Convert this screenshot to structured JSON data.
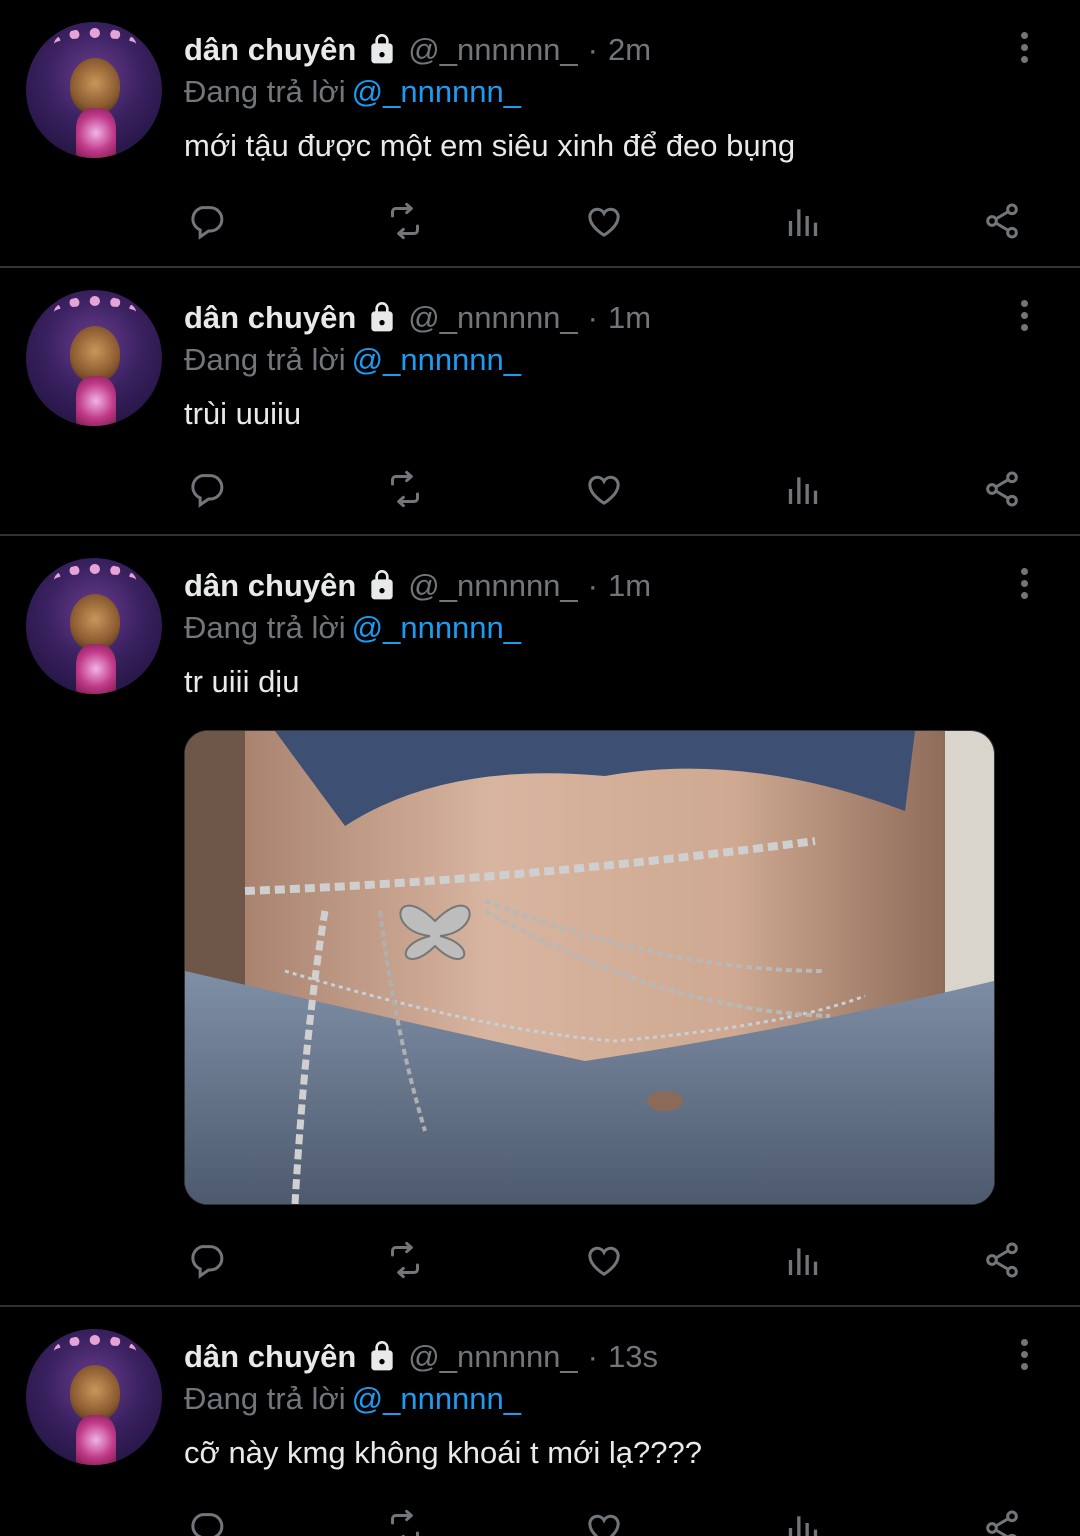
{
  "tweets": [
    {
      "name": "dân chuyên",
      "handle": "@_nnnnnn_",
      "time": "2m",
      "reply_prefix": "Đang trả lời",
      "reply_to": "@_nnnnnn_",
      "text": "mới tậu được một em siêu xinh để đeo bụng",
      "has_media": false
    },
    {
      "name": "dân chuyên",
      "handle": "@_nnnnnn_",
      "time": "1m",
      "reply_prefix": "Đang trả lời",
      "reply_to": "@_nnnnnn_",
      "text": "trùi uuiiu",
      "has_media": false
    },
    {
      "name": "dân chuyên",
      "handle": "@_nnnnnn_",
      "time": "1m",
      "reply_prefix": "Đang trả lời",
      "reply_to": "@_nnnnnn_",
      "text": "tr uiii dịu",
      "has_media": true
    },
    {
      "name": "dân chuyên",
      "handle": "@_nnnnnn_",
      "time": "13s",
      "reply_prefix": "Đang trả lời",
      "reply_to": "@_nnnnnn_",
      "text": "cỡ này kmg không khoái t mới lạ????",
      "has_media": false
    }
  ],
  "separator": "·",
  "icons": {
    "lock": "lock-icon",
    "more": "more-vertical-icon",
    "reply": "reply-bubble-icon",
    "retweet": "retweet-icon",
    "like": "heart-icon",
    "views": "analytics-bars-icon",
    "share": "share-icon"
  },
  "colors": {
    "background": "#000000",
    "text": "#e7e9ea",
    "muted": "#71767b",
    "accent": "#1d9bf0",
    "divider": "#2f3336"
  }
}
